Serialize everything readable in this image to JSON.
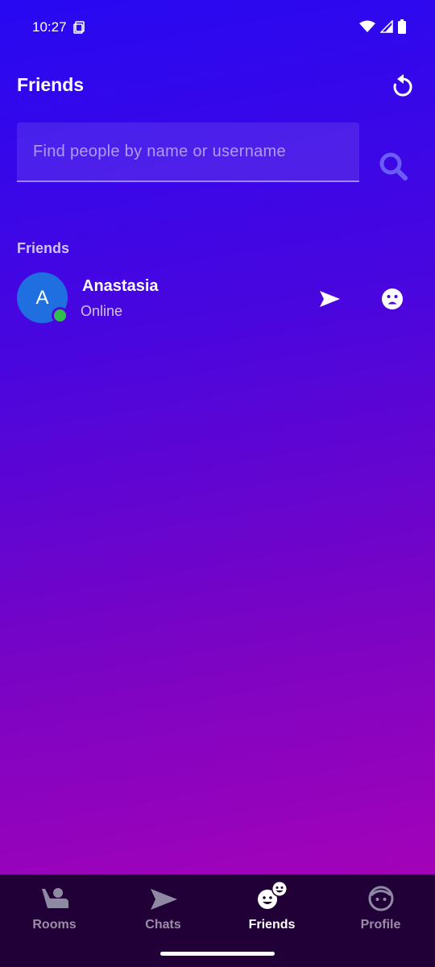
{
  "status_bar": {
    "time": "10:27"
  },
  "header": {
    "title": "Friends"
  },
  "search": {
    "placeholder": "Find people by name or username",
    "value": ""
  },
  "friends_section": {
    "label": "Friends",
    "items": [
      {
        "initial": "A",
        "name": "Anastasia",
        "status": "Online",
        "online": true
      }
    ]
  },
  "bottom_nav": {
    "items": [
      {
        "label": "Rooms",
        "icon": "rooms-icon",
        "active": false
      },
      {
        "label": "Chats",
        "icon": "chats-icon",
        "active": false
      },
      {
        "label": "Friends",
        "icon": "friends-icon",
        "active": true
      },
      {
        "label": "Profile",
        "icon": "profile-icon",
        "active": false
      }
    ]
  },
  "colors": {
    "gradient_top": "#2708f2",
    "gradient_bottom": "#b102b4",
    "nav_bg": "#210038",
    "avatar_bg": "#1f6fe0",
    "online": "#2fbf4d"
  }
}
